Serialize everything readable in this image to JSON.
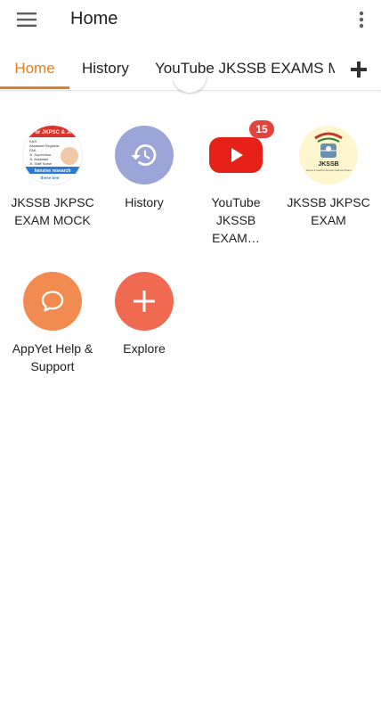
{
  "toolbar": {
    "title": "Home"
  },
  "tabs": [
    {
      "label": "Home",
      "active": true
    },
    {
      "label": "History"
    },
    {
      "label": "YouTube JKSSB EXAMS MOCK"
    }
  ],
  "grid": [
    {
      "label": "JKSSB JKPSC EXAM MOCK",
      "icon": "jkssb-mock-thumbnail-icon",
      "thumb_lines": [
        "For JKPSC & JK",
        "KAS",
        "Assistant Registrar",
        "FAA",
        "Jr. Supervisor",
        "Jr. Assistant",
        "Jr. Staff Nurse",
        "hensive research",
        "these ben"
      ]
    },
    {
      "label": "History",
      "icon": "history-icon",
      "color": "#9ba5d8"
    },
    {
      "label": "YouTube JKSSB EXAM…",
      "icon": "youtube-icon",
      "badge": "15",
      "color": "#e62117"
    },
    {
      "label": "JKSSB JKPSC EXAM",
      "icon": "jkssb-emblem-icon",
      "emblem_text": "JKSSB",
      "emblem_sub": "Jammu & Kashmir Services Selection Board"
    },
    {
      "label": "AppYet Help & Support",
      "icon": "chat-bubble-icon",
      "color": "#f28b50"
    },
    {
      "label": "Explore",
      "icon": "plus-icon",
      "color": "#f06a52"
    }
  ],
  "colors": {
    "accent": "#e67e22",
    "badge": "#e0443c"
  }
}
